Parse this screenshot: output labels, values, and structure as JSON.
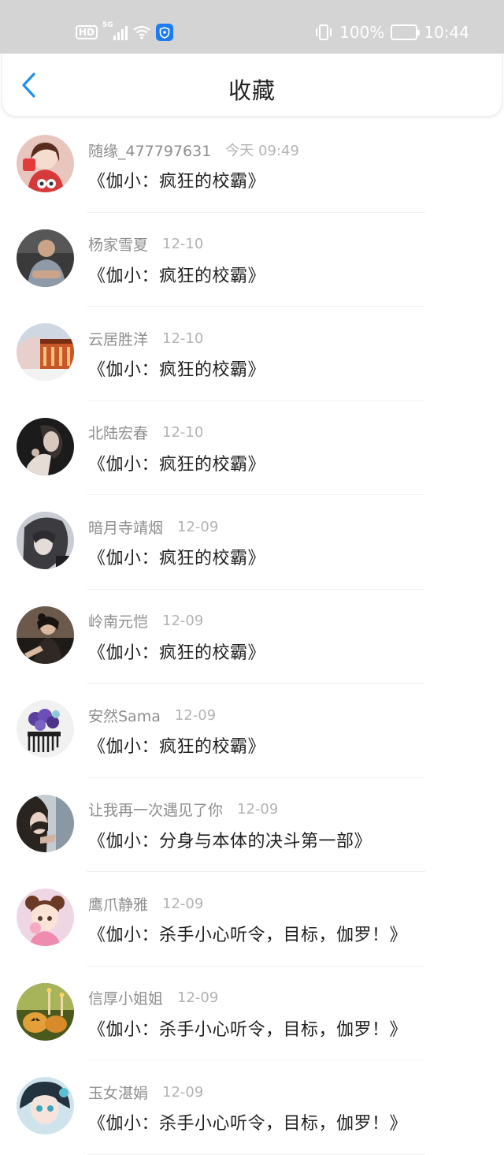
{
  "status_bar": {
    "hd": "HD",
    "network": "5G",
    "battery": "100%",
    "time": "10:44"
  },
  "header": {
    "title": "收藏"
  },
  "items": [
    {
      "name": "随缘_477797631",
      "time": "今天 09:49",
      "title": "《伽小：疯狂的校霸》"
    },
    {
      "name": "杨家雪夏",
      "time": "12-10",
      "title": "《伽小：疯狂的校霸》"
    },
    {
      "name": "云居胜洋",
      "time": "12-10",
      "title": "《伽小：疯狂的校霸》"
    },
    {
      "name": "北陆宏春",
      "time": "12-10",
      "title": "《伽小：疯狂的校霸》"
    },
    {
      "name": "暗月寺靖烟",
      "time": "12-09",
      "title": "《伽小：疯狂的校霸》"
    },
    {
      "name": "岭南元恺",
      "time": "12-09",
      "title": "《伽小：疯狂的校霸》"
    },
    {
      "name": "安然Sama",
      "time": "12-09",
      "title": "《伽小：疯狂的校霸》"
    },
    {
      "name": "让我再一次遇见了你",
      "time": "12-09",
      "title": "《伽小：分身与本体的决斗第一部》"
    },
    {
      "name": "鹰爪静雅",
      "time": "12-09",
      "title": "《伽小：杀手小心听令，目标，伽罗！》"
    },
    {
      "name": "信厚小姐姐",
      "time": "12-09",
      "title": "《伽小：杀手小心听令，目标，伽罗！》"
    },
    {
      "name": "玉女湛娟",
      "time": "12-09",
      "title": "《伽小：杀手小心听令，目标，伽罗！》"
    }
  ]
}
